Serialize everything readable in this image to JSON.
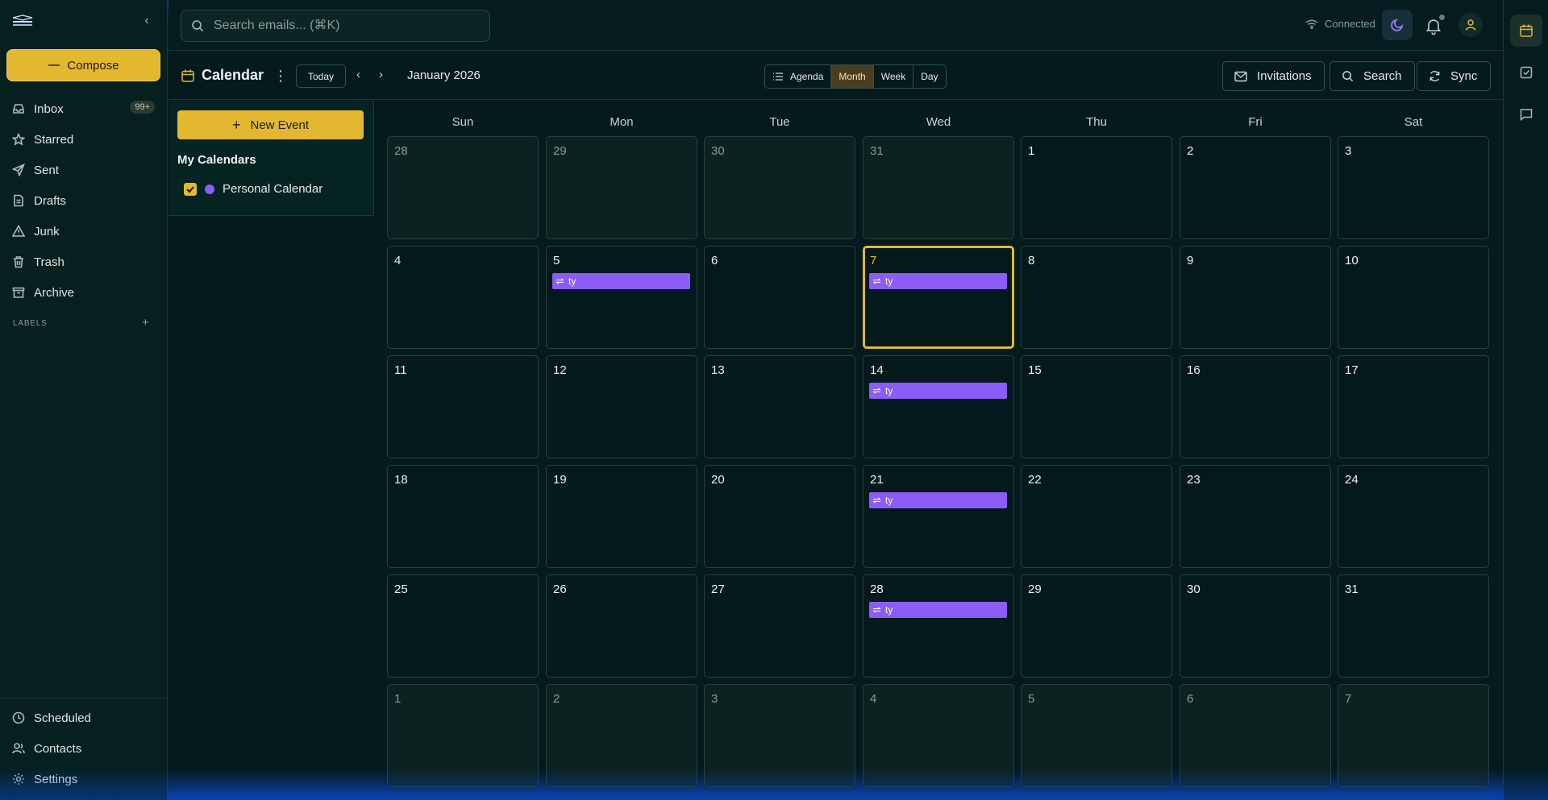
{
  "sidebar": {
    "compose_label": "Compose",
    "nav": [
      {
        "label": "Inbox",
        "icon": "inbox-icon",
        "badge": "99+"
      },
      {
        "label": "Starred",
        "icon": "star-icon"
      },
      {
        "label": "Sent",
        "icon": "send-icon"
      },
      {
        "label": "Drafts",
        "icon": "draft-icon"
      },
      {
        "label": "Junk",
        "icon": "warning-icon"
      },
      {
        "label": "Trash",
        "icon": "trash-icon"
      },
      {
        "label": "Archive",
        "icon": "archive-icon"
      }
    ],
    "labels_header": "LABELS",
    "bottom": [
      {
        "label": "Scheduled",
        "icon": "clock-icon"
      },
      {
        "label": "Contacts",
        "icon": "contacts-icon"
      },
      {
        "label": "Settings",
        "icon": "gear-icon"
      }
    ]
  },
  "topbar": {
    "search_placeholder": "Search emails... (⌘K)",
    "connection_status": "Connected"
  },
  "calendar_header": {
    "title": "Calendar",
    "today_label": "Today",
    "month_label": "January 2026",
    "views": [
      {
        "label": "Agenda",
        "active": false
      },
      {
        "label": "Month",
        "active": true
      },
      {
        "label": "Week",
        "active": false
      },
      {
        "label": "Day",
        "active": false
      }
    ],
    "invitations_label": "Invitations",
    "search_label": "Search",
    "sync_label": "Sync"
  },
  "calendar_side": {
    "new_event_label": "New Event",
    "my_calendars_title": "My Calendars",
    "calendars": [
      {
        "name": "Personal Calendar",
        "color": "#8b5cf6",
        "checked": true
      }
    ]
  },
  "grid": {
    "weekdays": [
      "Sun",
      "Mon",
      "Tue",
      "Wed",
      "Thu",
      "Fri",
      "Sat"
    ],
    "weeks": [
      [
        {
          "d": "28",
          "o": true
        },
        {
          "d": "29",
          "o": true
        },
        {
          "d": "30",
          "o": true
        },
        {
          "d": "31",
          "o": true
        },
        {
          "d": "1"
        },
        {
          "d": "2"
        },
        {
          "d": "3"
        }
      ],
      [
        {
          "d": "4"
        },
        {
          "d": "5",
          "e": "ty"
        },
        {
          "d": "6"
        },
        {
          "d": "7",
          "e": "ty",
          "t": true
        },
        {
          "d": "8"
        },
        {
          "d": "9"
        },
        {
          "d": "10"
        }
      ],
      [
        {
          "d": "11"
        },
        {
          "d": "12"
        },
        {
          "d": "13"
        },
        {
          "d": "14",
          "e": "ty"
        },
        {
          "d": "15"
        },
        {
          "d": "16"
        },
        {
          "d": "17"
        }
      ],
      [
        {
          "d": "18"
        },
        {
          "d": "19"
        },
        {
          "d": "20"
        },
        {
          "d": "21",
          "e": "ty"
        },
        {
          "d": "22"
        },
        {
          "d": "23"
        },
        {
          "d": "24"
        }
      ],
      [
        {
          "d": "25"
        },
        {
          "d": "26"
        },
        {
          "d": "27"
        },
        {
          "d": "28",
          "e": "ty"
        },
        {
          "d": "29"
        },
        {
          "d": "30"
        },
        {
          "d": "31"
        }
      ],
      [
        {
          "d": "1",
          "o": true
        },
        {
          "d": "2",
          "o": true
        },
        {
          "d": "3",
          "o": true
        },
        {
          "d": "4",
          "o": true
        },
        {
          "d": "5",
          "o": true
        },
        {
          "d": "6",
          "o": true
        },
        {
          "d": "7",
          "o": true
        }
      ]
    ]
  },
  "colors": {
    "accent": "#e3b830",
    "event": "#8b5cf6",
    "background": "#041a1c"
  }
}
